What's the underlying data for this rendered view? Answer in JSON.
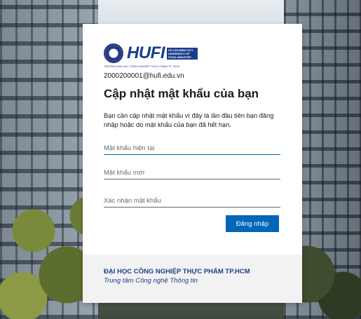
{
  "branding": {
    "logo_text": "HUFI",
    "logo_side_text": "HO CHI MINH CITY UNIVERSITY OF FOOD INDUSTRY",
    "logo_sub_text": "TRƯỜNG ĐẠI HỌC CÔNG NGHIỆP THỰC PHẨM TP. HCM"
  },
  "account": {
    "email": "2000200001@hufi.edu.vn"
  },
  "heading": "Cập nhật mật khẩu của bạn",
  "description": "Bạn cần cập nhật mật khẩu vì đây là lần đầu tiên bạn đăng nhập hoặc do mật khẩu của bạn đã hết hạn.",
  "fields": {
    "current_password": {
      "placeholder": "Mật khẩu hiện tại",
      "value": ""
    },
    "new_password": {
      "placeholder": "Mật khẩu mới",
      "value": ""
    },
    "confirm_password": {
      "placeholder": "Xác nhận mật khẩu",
      "value": ""
    }
  },
  "submit_label": "Đăng nhập",
  "footer": {
    "organization": "ĐẠI HỌC CÔNG NGHIỆP THỰC PHẨM TP.HCM",
    "department": "Trung tâm Công nghệ Thông tin"
  },
  "colors": {
    "primary": "#0067b8",
    "brand": "#1a3e8c",
    "footer_bg": "#f2f2f2"
  }
}
